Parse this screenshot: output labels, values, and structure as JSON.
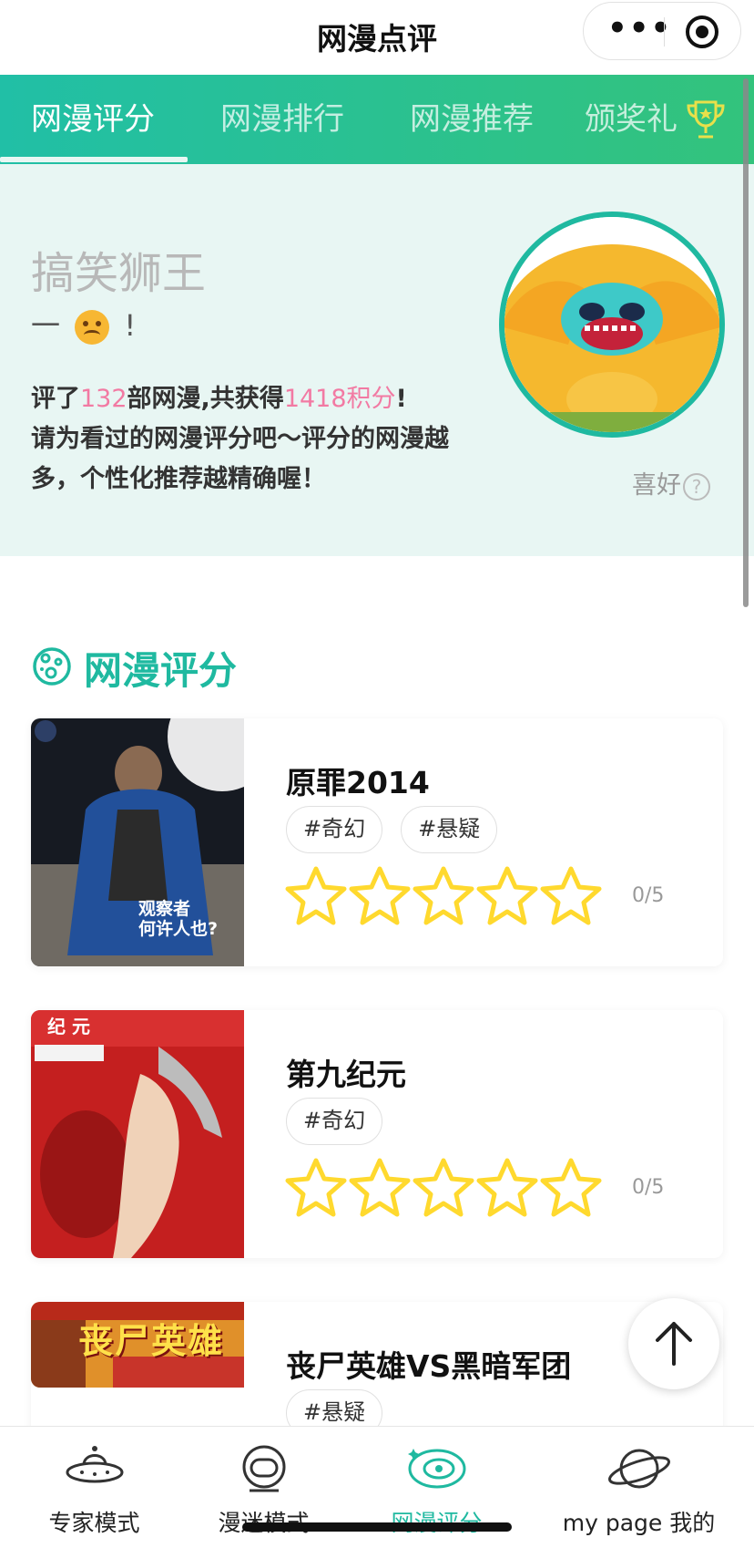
{
  "header": {
    "title": "网漫点评"
  },
  "tabs": [
    {
      "label": "网漫评分"
    },
    {
      "label": "网漫排行"
    },
    {
      "label": "网漫推荐"
    },
    {
      "label": "颁奖礼"
    }
  ],
  "hero": {
    "name": "搞笑狮王",
    "mood_prefix": "一",
    "mood_suffix": "!",
    "stats_line1_a": "评了",
    "rated_count": "132",
    "stats_line1_b": "部网漫,共获得",
    "points": "1418积分",
    "stats_line1_c": "!",
    "stats_line2": "请为看过的网漫评分吧～评分的网漫越多，个性化推荐越精确喔！",
    "preference_label": "喜好",
    "help_mark": "?"
  },
  "section": {
    "title": "网漫评分"
  },
  "comics": [
    {
      "title": "原罪2014",
      "tags": [
        "#奇幻",
        "#悬疑"
      ],
      "score": "0/5",
      "rating": 0,
      "cover_text": "观察者\n何许人也?"
    },
    {
      "title": "第九纪元",
      "tags": [
        "#奇幻"
      ],
      "score": "0/5",
      "rating": 0,
      "cover_text": "纪 元"
    },
    {
      "title": "丧尸英雄VS黑暗军团",
      "tags": [
        "#悬疑"
      ],
      "score": "",
      "rating": 0,
      "cover_text": "丧尸英雄"
    }
  ],
  "bottom_nav": [
    {
      "label": "专家模式",
      "icon": "ufo-icon"
    },
    {
      "label": "漫迷模式",
      "icon": "astronaut-icon"
    },
    {
      "label": "网漫评分",
      "icon": "galaxy-icon",
      "active": true
    },
    {
      "label": "my page 我的",
      "icon": "planet-icon"
    }
  ],
  "colors": {
    "accent": "#1fb9a0",
    "tab_gradient_end": "#33c37c",
    "pink": "#f27aa3",
    "star": "#ffd92e",
    "hero_bg": "#e8f6f3"
  }
}
